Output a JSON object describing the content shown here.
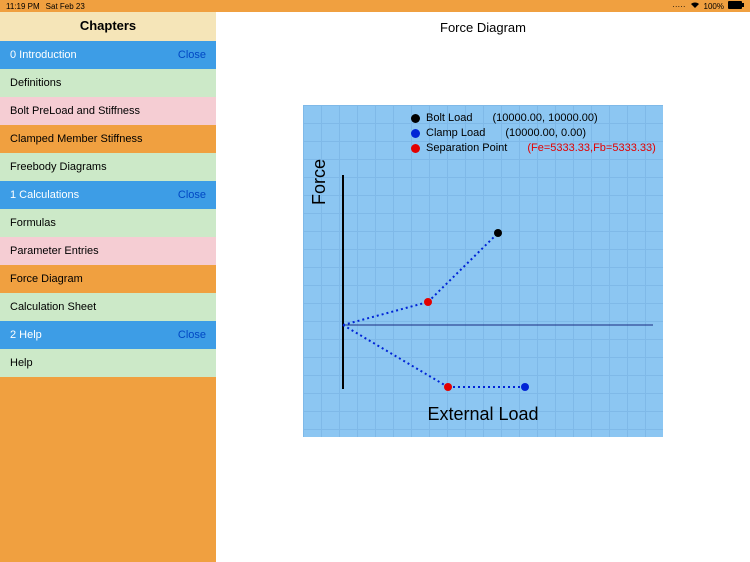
{
  "status": {
    "time": "11:19 PM",
    "date": "Sat Feb 23",
    "battery": "100%"
  },
  "sidebar": {
    "title": "Chapters",
    "sections": [
      {
        "label": "0 Introduction",
        "action": "Close",
        "style": "blue-row"
      },
      {
        "label": "Definitions",
        "style": "green-row"
      },
      {
        "label": "Bolt PreLoad and Stiffness",
        "style": "pink-row"
      },
      {
        "label": "Clamped Member Stiffness",
        "style": "orange-row"
      },
      {
        "label": "Freebody Diagrams",
        "style": "green-row"
      },
      {
        "label": "1 Calculations",
        "action": "Close",
        "style": "blue-row"
      },
      {
        "label": "Formulas",
        "style": "green-row"
      },
      {
        "label": "Parameter Entries",
        "style": "pink-row"
      },
      {
        "label": "Force Diagram",
        "style": "orange-row"
      },
      {
        "label": "Calculation Sheet",
        "style": "green-row"
      },
      {
        "label": "2 Help",
        "action": "Close",
        "style": "blue-row"
      },
      {
        "label": "Help",
        "style": "green-row"
      }
    ]
  },
  "main": {
    "title": "Force Diagram"
  },
  "chart_data": {
    "type": "line",
    "ylabel": "Force",
    "xlabel": "External Load",
    "legend": [
      {
        "name": "Bolt Load",
        "color": "#000000",
        "value": "(10000.00, 10000.00)"
      },
      {
        "name": "Clamp Load",
        "color": "#0024d6",
        "value": "(10000.00,  0.00)"
      },
      {
        "name": "Separation Point",
        "color": "#e30000",
        "value": "(Fe=5333.33,Fb=5333.33)"
      }
    ],
    "axis_origin": {
      "external_load": 0,
      "force": 5000
    },
    "series": [
      {
        "name": "Bolt Load line",
        "points": [
          {
            "external_load": 0,
            "force": 5000
          },
          {
            "external_load": 5333.33,
            "force": 7666.67
          },
          {
            "external_load": 10000,
            "force": 10000
          }
        ],
        "endpoint_marker": "black"
      },
      {
        "name": "Clamp Load line",
        "points": [
          {
            "external_load": 0,
            "force": 5000
          },
          {
            "external_load": 5333.33,
            "force": 2333.33
          },
          {
            "external_load": 10000,
            "force": 0
          }
        ],
        "endpoint_marker": "blue"
      }
    ],
    "separation_points": [
      {
        "external_load": 5333.33,
        "force": 7666.67
      },
      {
        "external_load": 5333.33,
        "force": 2333.33
      }
    ],
    "horizontal_reference": {
      "force": 5000
    }
  }
}
